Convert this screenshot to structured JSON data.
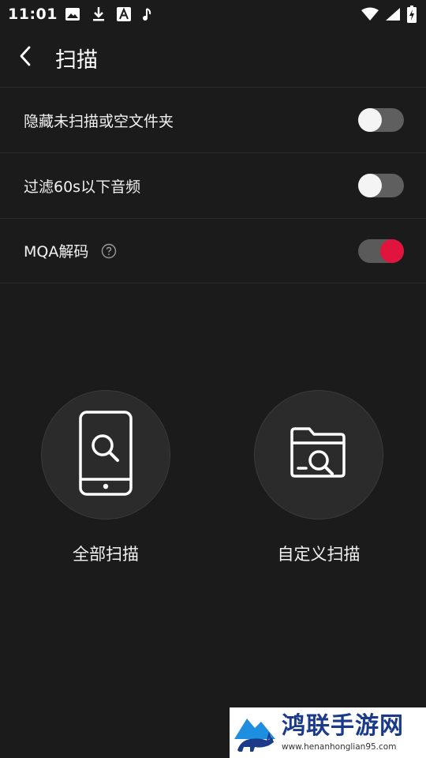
{
  "status_bar": {
    "time": "11:01",
    "left_icons": [
      "image-icon",
      "download-icon",
      "app-a-icon",
      "music-note-icon"
    ],
    "right_icons": [
      "wifi-icon",
      "signal-icon",
      "battery-charging-icon"
    ]
  },
  "app_bar": {
    "back_icon": "chevron-left-icon",
    "title": "扫描"
  },
  "settings": [
    {
      "label": "隐藏未扫描或空文件夹",
      "enabled": false
    },
    {
      "label": "过滤60s以下音频",
      "enabled": false
    },
    {
      "label": "MQA解码",
      "enabled": true,
      "help_icon": "question-circle-icon"
    }
  ],
  "scan_options": {
    "all": {
      "label": "全部扫描",
      "icon": "phone-search-icon"
    },
    "custom": {
      "label": "自定义扫描",
      "icon": "folder-search-icon"
    }
  },
  "watermark": {
    "title": "鸿联手游网",
    "url": "www.henanhonglian95.com"
  },
  "colors": {
    "background": "#1b1b1b",
    "accent": "#e0143c",
    "toggle_off_track": "#5f5f5f"
  }
}
